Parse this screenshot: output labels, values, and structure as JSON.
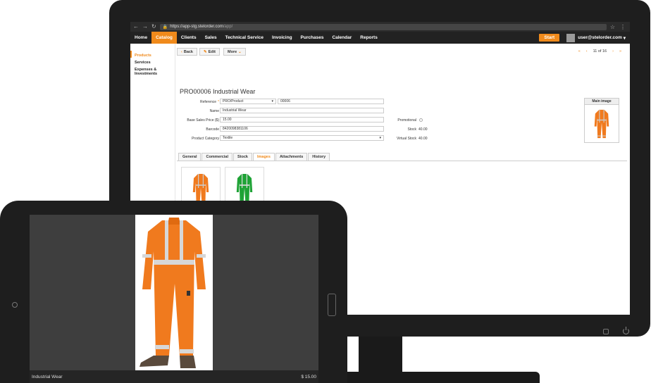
{
  "browser": {
    "url_host": "https://app-stg.stelorder.com",
    "url_path": "/app/"
  },
  "nav": {
    "items": [
      "Home",
      "Catalog",
      "Clients",
      "Sales",
      "Technical Service",
      "Invoicing",
      "Purchases",
      "Calendar",
      "Reports"
    ],
    "active": "Catalog",
    "start_label": "Start",
    "user_email": "user@stelorder.com"
  },
  "sidebar": {
    "items": [
      "Products",
      "Services",
      "Expenses &",
      "Investments"
    ]
  },
  "toolbar": {
    "back_label": "Back",
    "edit_label": "Edit",
    "more_label": "More",
    "pager_text": "11 of 16"
  },
  "product": {
    "title": "PRO00006 Industrial Wear",
    "labels": {
      "reference": "Reference",
      "name": "Name",
      "base_price": "Base Sales Price ($)",
      "barcode": "Barcode",
      "category": "Product Category",
      "promotional": "Promotional",
      "stock": "Stock",
      "virtual_stock": "Virtual Stock"
    },
    "reference_prefix": "PRO/Product",
    "reference_number": "00006",
    "name": "Industrial Wear",
    "base_price": "15.00",
    "barcode": "8420098381106",
    "category": "Textile",
    "stock": "40.00",
    "virtual_stock": "40.00",
    "main_image_label": "Main image"
  },
  "tabs": [
    "General",
    "Commercial",
    "Stock",
    "Images",
    "Attachments",
    "History"
  ],
  "active_tab": "Images",
  "tablet": {
    "caption_name": "Industrial Wear",
    "caption_price": "$ 15.00"
  },
  "colors": {
    "accent": "#f08a1b",
    "coverall_orange": "#f07a1e",
    "coverall_green": "#1fa336",
    "device": "#1e1e1e"
  }
}
